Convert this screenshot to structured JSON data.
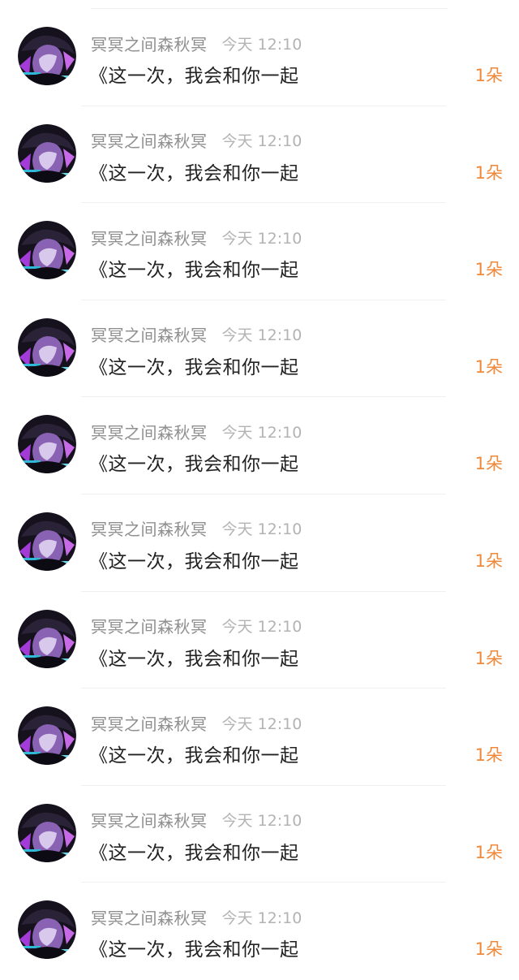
{
  "feed": {
    "items": [
      {
        "author": "冥冥之间森秋冥",
        "time": "今天 12:10",
        "message": "《这一次，我会和你一起",
        "count": "1朵"
      },
      {
        "author": "冥冥之间森秋冥",
        "time": "今天 12:10",
        "message": "《这一次，我会和你一起",
        "count": "1朵"
      },
      {
        "author": "冥冥之间森秋冥",
        "time": "今天 12:10",
        "message": "《这一次，我会和你一起",
        "count": "1朵"
      },
      {
        "author": "冥冥之间森秋冥",
        "time": "今天 12:10",
        "message": "《这一次，我会和你一起",
        "count": "1朵"
      },
      {
        "author": "冥冥之间森秋冥",
        "time": "今天 12:10",
        "message": "《这一次，我会和你一起",
        "count": "1朵"
      },
      {
        "author": "冥冥之间森秋冥",
        "time": "今天 12:10",
        "message": "《这一次，我会和你一起",
        "count": "1朵"
      },
      {
        "author": "冥冥之间森秋冥",
        "time": "今天 12:10",
        "message": "《这一次，我会和你一起",
        "count": "1朵"
      },
      {
        "author": "冥冥之间森秋冥",
        "time": "今天 12:10",
        "message": "《这一次，我会和你一起",
        "count": "1朵"
      },
      {
        "author": "冥冥之间森秋冥",
        "time": "今天 12:10",
        "message": "《这一次，我会和你一起",
        "count": "1朵"
      },
      {
        "author": "冥冥之间森秋冥",
        "time": "今天 12:10",
        "message": "《这一次，我会和你一起",
        "count": "1朵"
      }
    ]
  },
  "colors": {
    "author": "#8f8f8f",
    "time": "#b3b3b3",
    "message": "#222222",
    "count_accent": "#f0883a",
    "divider": "#f0f0f0"
  },
  "icons": {
    "avatar": "user-avatar-image"
  }
}
